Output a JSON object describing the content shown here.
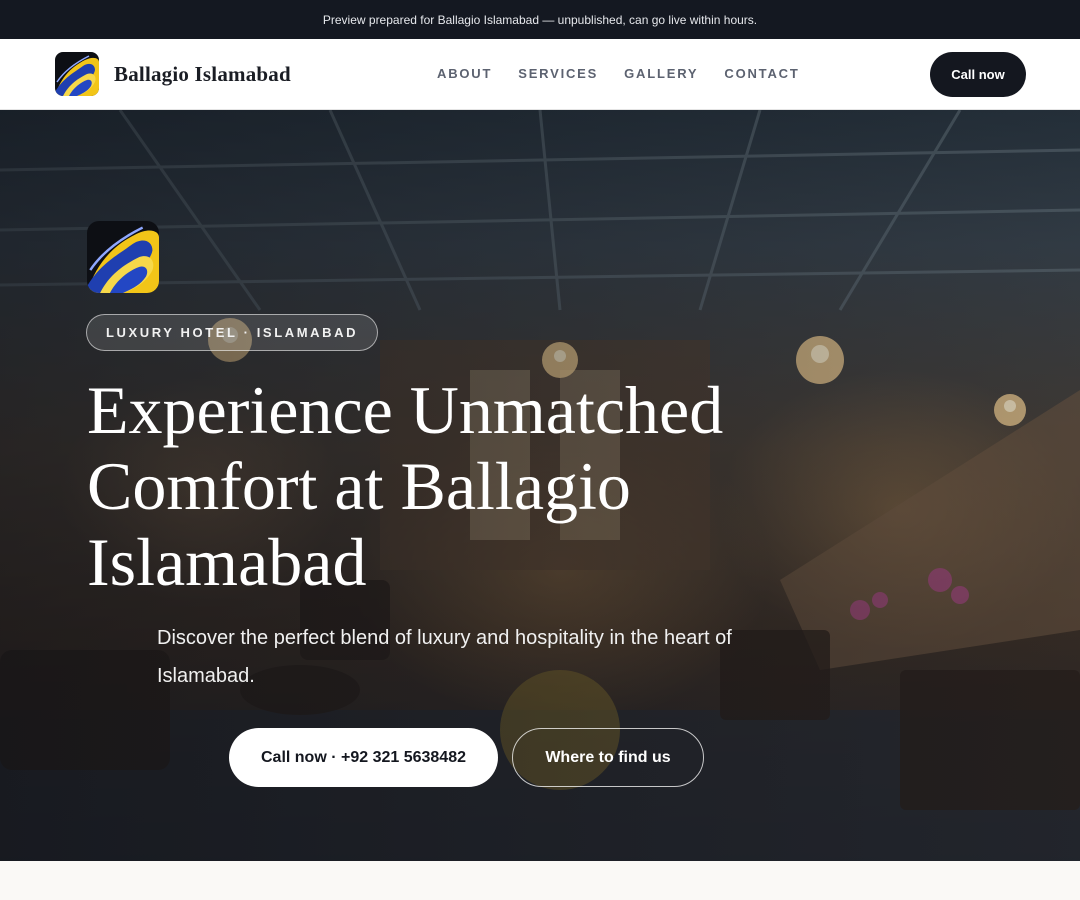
{
  "preview_banner": {
    "text": "Preview prepared for Ballagio Islamabad — unpublished, can go live within hours."
  },
  "navbar": {
    "logo_icon": "abstract-swirl-logo",
    "brand_name": "Ballagio Islamabad",
    "links": [
      {
        "label": "ABOUT"
      },
      {
        "label": "SERVICES"
      },
      {
        "label": "GALLERY"
      },
      {
        "label": "CONTACT"
      }
    ],
    "cta_label": "Call now"
  },
  "hero": {
    "background": "hotel-lobby-photo",
    "logo_icon": "abstract-swirl-logo",
    "eyebrow": "LUXURY HOTEL · ISLAMABAD",
    "title": "Experience Unmatched Comfort at Ballagio Islamabad",
    "subtitle": "Discover the perfect blend of luxury and hospitality in the heart of Islamabad.",
    "primary_button": "Call now · +92 321 5638482",
    "secondary_button": "Where to find us"
  },
  "colors": {
    "preview_bar_bg": "#141821",
    "dark_accent": "#14171f",
    "nav_link": "#5c6270",
    "logo_blue": "#1f3fb0",
    "logo_yellow": "#f2c518"
  }
}
